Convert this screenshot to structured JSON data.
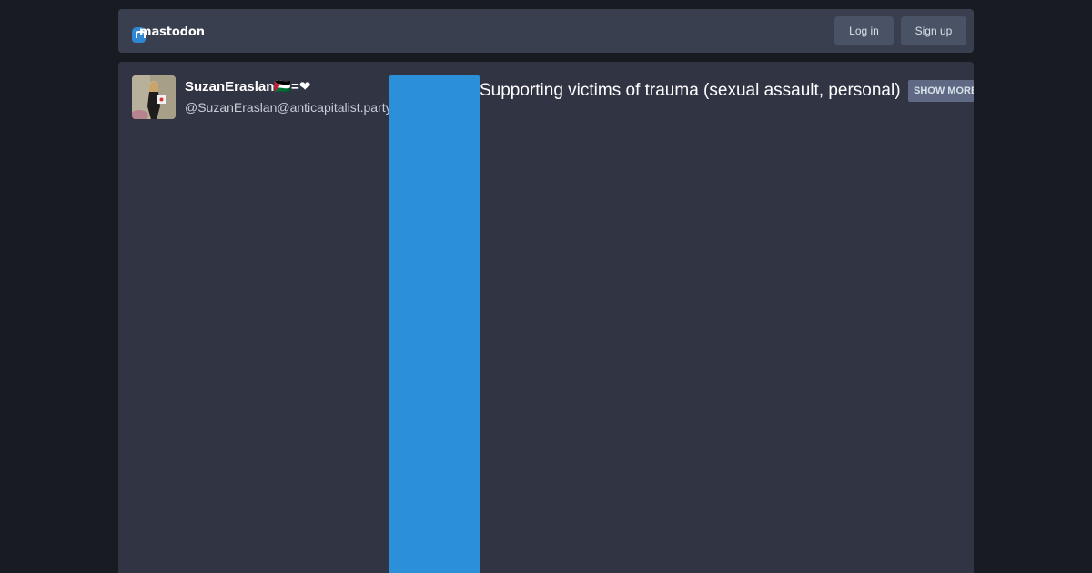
{
  "header": {
    "logo_text": "mastodon",
    "login_label": "Log in",
    "signup_label": "Sign up"
  },
  "status": {
    "display_name": "SuzanEraslan🇵🇸=❤",
    "handle": "@SuzanEraslan@anticapitalist.party",
    "content_warning": "Supporting victims of trauma (sexual assault, personal)",
    "show_more_label": "SHOW MORE"
  },
  "colors": {
    "page_background": "#191b22",
    "header_background": "#393f4f",
    "panel_background": "#313543",
    "accent_blue": "#2b90d9",
    "button_background": "#4a5266",
    "show_more_background": "#606984"
  }
}
